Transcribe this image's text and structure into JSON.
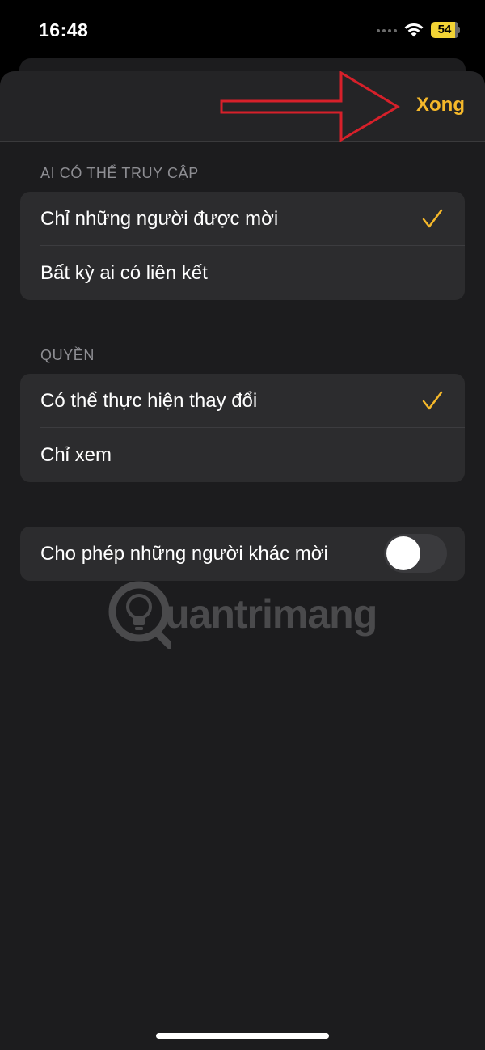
{
  "status_bar": {
    "time": "16:48",
    "battery_level": "54",
    "battery_color": "#f2d335"
  },
  "nav": {
    "done_label": "Xong",
    "accent_color": "#f5b82a"
  },
  "access": {
    "header": "AI CÓ THỂ TRUY CẬP",
    "options": [
      {
        "label": "Chỉ những người được mời",
        "selected": true
      },
      {
        "label": "Bất kỳ ai có liên kết",
        "selected": false
      }
    ]
  },
  "permissions": {
    "header": "QUYỀN",
    "options": [
      {
        "label": "Có thể thực hiện thay đổi",
        "selected": true
      },
      {
        "label": "Chỉ xem",
        "selected": false
      }
    ]
  },
  "allow_invite": {
    "label": "Cho phép những người khác mời",
    "enabled": false
  },
  "watermark": {
    "text": "uantrimang"
  },
  "icons": [
    "wifi-icon",
    "battery-icon",
    "checkmark-icon",
    "arrow-annotation",
    "toggle-switch",
    "lightbulb-logo-icon"
  ]
}
